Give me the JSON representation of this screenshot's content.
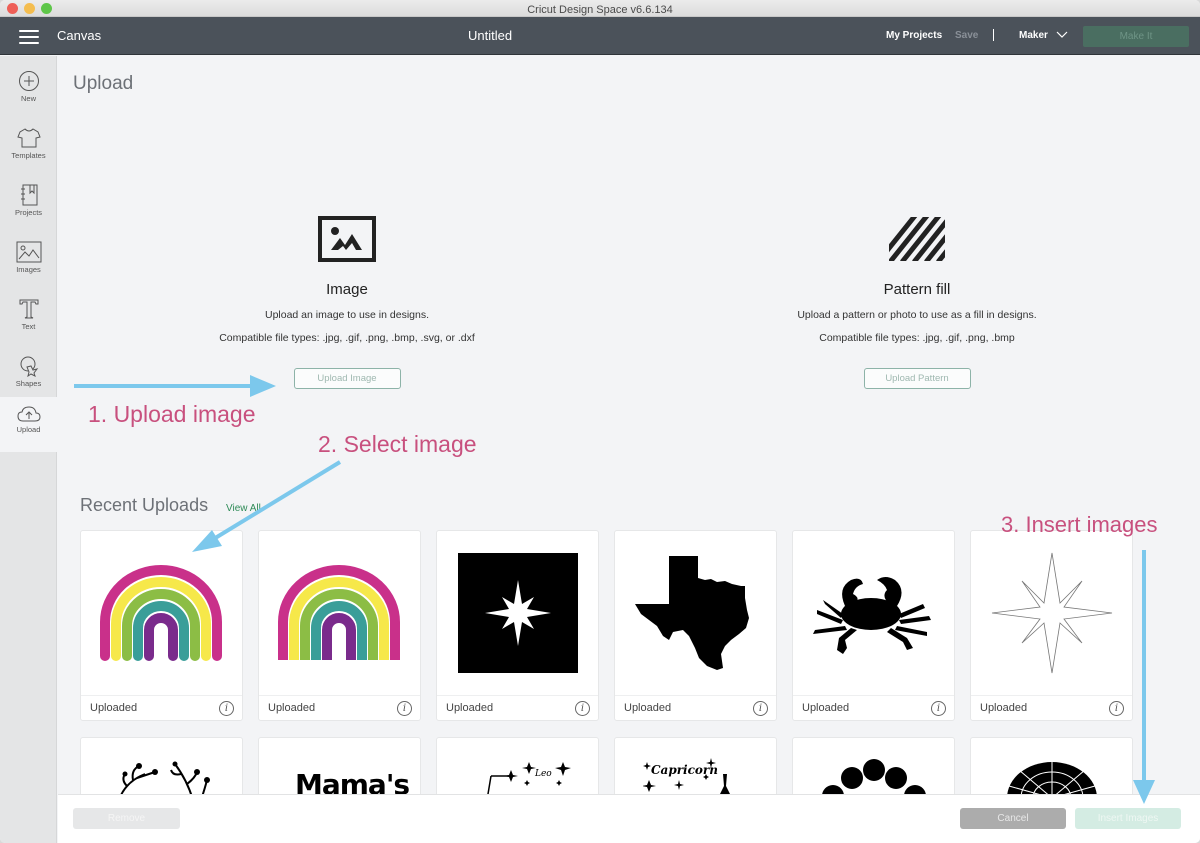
{
  "window": {
    "title": "Cricut Design Space  v6.6.134"
  },
  "appbar": {
    "section": "Canvas",
    "doc_title": "Untitled",
    "my_projects": "My Projects",
    "save": "Save",
    "machine": "Maker",
    "make_it": "Make It"
  },
  "sidebar": {
    "items": [
      {
        "label": "New",
        "icon": "plus-circle-icon"
      },
      {
        "label": "Templates",
        "icon": "tshirt-icon"
      },
      {
        "label": "Projects",
        "icon": "notebook-icon"
      },
      {
        "label": "Images",
        "icon": "image-icon"
      },
      {
        "label": "Text",
        "icon": "text-icon"
      },
      {
        "label": "Shapes",
        "icon": "shapes-icon"
      },
      {
        "label": "Upload",
        "icon": "cloud-upload-icon",
        "active": true
      }
    ]
  },
  "main": {
    "title": "Upload",
    "image_option": {
      "title": "Image",
      "description": "Upload an image to use in designs.",
      "types": "Compatible file types: .jpg, .gif, .png, .bmp, .svg, or .dxf",
      "button": "Upload Image"
    },
    "pattern_option": {
      "title": "Pattern fill",
      "description": "Upload a pattern or photo to use as a fill in designs.",
      "types": "Compatible file types: .jpg, .gif, .png, .bmp",
      "button": "Upload Pattern"
    },
    "recent": {
      "title": "Recent Uploads",
      "view_all": "View All",
      "tiles": [
        {
          "label": "Uploaded",
          "art": "rainbow-rounded"
        },
        {
          "label": "Uploaded",
          "art": "rainbow-flat"
        },
        {
          "label": "Uploaded",
          "art": "star-square-black"
        },
        {
          "label": "Uploaded",
          "art": "texas-silhouette"
        },
        {
          "label": "Uploaded",
          "art": "crab-silhouette"
        },
        {
          "label": "Uploaded",
          "art": "star-outline"
        }
      ],
      "tiles_row2": [
        {
          "art": "floral-branches"
        },
        {
          "art": "mamas-text",
          "text": "Mama's"
        },
        {
          "art": "leo-constellation",
          "text": "Leo"
        },
        {
          "art": "capricorn-constellation",
          "text": "Capricorn"
        },
        {
          "art": "moon-phases"
        },
        {
          "art": "mandala-half"
        }
      ]
    }
  },
  "footer": {
    "remove": "Remove",
    "cancel": "Cancel",
    "insert": "Insert Images"
  },
  "annotations": {
    "step1": "1. Upload image",
    "step2": "2. Select image",
    "step3": "3. Insert images",
    "color": "#c8507e",
    "arrow_color": "#7cc8ec"
  }
}
